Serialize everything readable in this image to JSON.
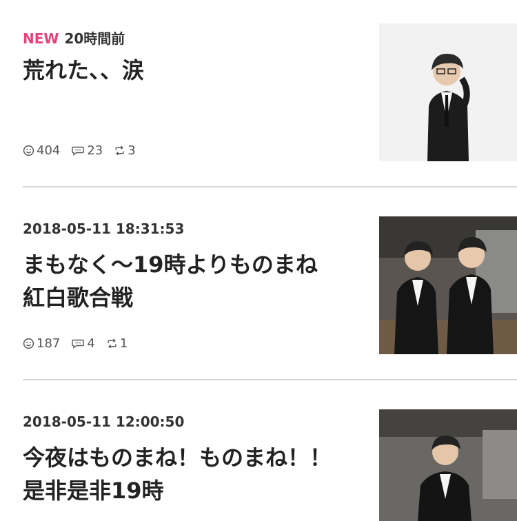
{
  "entries": [
    {
      "new_label": "NEW",
      "date": "20時間前",
      "title_lines": [
        "荒れた、、涙"
      ],
      "likes": "404",
      "comments": "23",
      "reblogs": "3",
      "thumbnail_icon": "person-in-suit-photo"
    },
    {
      "date": "2018-05-11 18:31:53",
      "title_lines": [
        "まもなく〜19時よりものまね",
        "紅白歌合戦"
      ],
      "likes": "187",
      "comments": "4",
      "reblogs": "1",
      "thumbnail_icon": "two-people-backstage-photo"
    },
    {
      "date": "2018-05-11 12:00:50",
      "title_lines": [
        "今夜はものまね！ものまね！！",
        "是非是非19時"
      ],
      "thumbnail_icon": "person-backstage-photo"
    }
  ],
  "colors": {
    "new_badge": "#e8437a",
    "divider": "#d8d8d8"
  }
}
